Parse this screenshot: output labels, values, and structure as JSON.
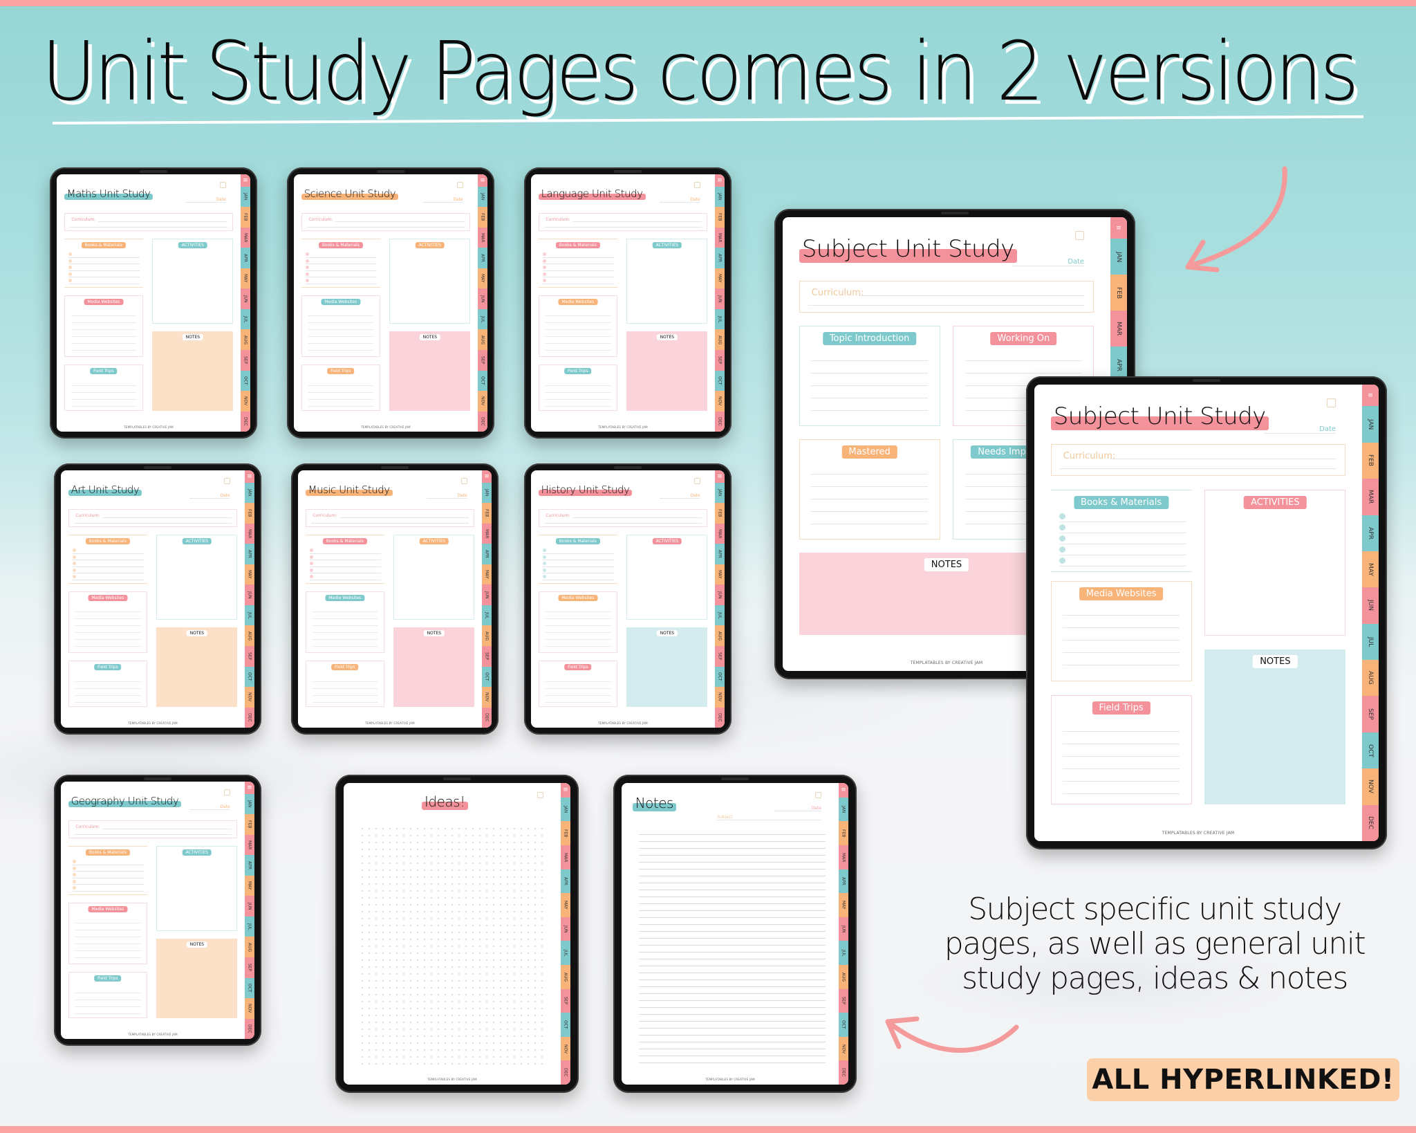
{
  "colors": {
    "teal": "#7ec9cb",
    "orange": "#f8b378",
    "pink": "#f4929b",
    "pink_light": "#fad4da",
    "orange_light": "#fde0c8",
    "teal_light": "#d4ecee",
    "accent_bar": "#f9a4a3",
    "badge_bg": "#fbcfa8"
  },
  "headline": "Unit Study Pages comes in 2 versions",
  "caption": {
    "line1": "Subject specific unit study",
    "line2": "pages, as well as general unit",
    "line3": "study pages, ideas & notes"
  },
  "badge": "ALL HYPERLINKED!",
  "common": {
    "curriculum_label": "Curriculum:",
    "date_label": "Date",
    "books_label": "Books & Materials",
    "activities_label": "ACTIVITIES",
    "media_label": "Media Websites",
    "trips_label": "Field Trips",
    "notes_label": "NOTES",
    "credit": "TEMPLATABLES BY CREATIVE JAM",
    "months": [
      "JAN",
      "FEB",
      "MAR",
      "APR",
      "MAY",
      "JUN",
      "JUL",
      "AUG",
      "SEP",
      "OCT",
      "NOV",
      "DEC"
    ]
  },
  "subject_pages": [
    {
      "title": "Maths Unit Study",
      "title_color": "teal",
      "books_color": "orange",
      "activities_color": "teal",
      "media_color": "pink",
      "trips_color": "teal",
      "notes_bg": "orange_light"
    },
    {
      "title": "Science Unit Study",
      "title_color": "orange",
      "books_color": "pink",
      "activities_color": "orange",
      "media_color": "teal",
      "trips_color": "orange",
      "notes_bg": "pink_light"
    },
    {
      "title": "Language Unit Study",
      "title_color": "pink",
      "books_color": "pink",
      "activities_color": "teal",
      "media_color": "orange",
      "trips_color": "teal",
      "notes_bg": "pink_light"
    },
    {
      "title": "Art Unit Study",
      "title_color": "teal",
      "books_color": "orange",
      "activities_color": "teal",
      "media_color": "pink",
      "trips_color": "teal",
      "notes_bg": "orange_light"
    },
    {
      "title": "Music Unit Study",
      "title_color": "orange",
      "books_color": "pink",
      "activities_color": "orange",
      "media_color": "teal",
      "trips_color": "orange",
      "notes_bg": "pink_light"
    },
    {
      "title": "History Unit Study",
      "title_color": "pink",
      "books_color": "teal",
      "activities_color": "pink",
      "media_color": "orange",
      "trips_color": "pink",
      "notes_bg": "teal_light"
    },
    {
      "title": "Geography Unit Study",
      "title_color": "teal",
      "books_color": "orange",
      "activities_color": "teal",
      "media_color": "pink",
      "trips_color": "teal",
      "notes_bg": "orange_light"
    }
  ],
  "general_page_a": {
    "title": "Subject Unit Study",
    "topic_label": "Topic Introduction",
    "working_label": "Working On",
    "mastered_label": "Mastered",
    "needs_label": "Needs Improvement",
    "notes_label": "NOTES"
  },
  "general_page_b": {
    "title": "Subject Unit Study"
  },
  "ideas_page": {
    "title": "Ideas!"
  },
  "notes_page": {
    "title": "Notes",
    "subject_label": "Subject"
  }
}
